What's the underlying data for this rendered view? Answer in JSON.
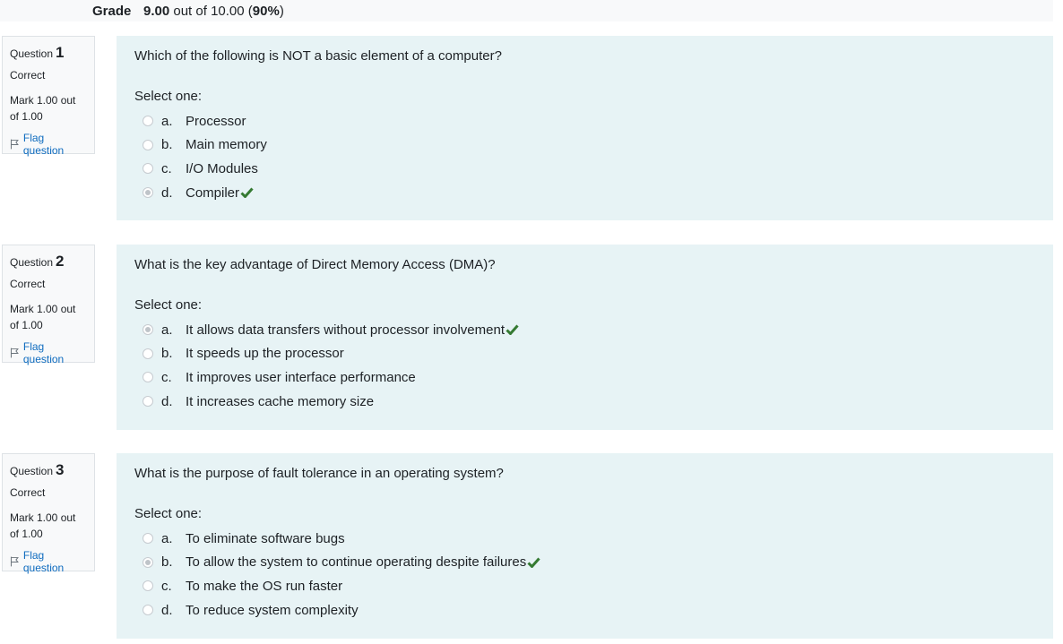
{
  "header": {
    "grade_label": "Grade",
    "grade_score": "9.00",
    "grade_out_of": " out of 10.00 (",
    "grade_percent": "90%",
    "grade_close": ")"
  },
  "questions": [
    {
      "label": "Question",
      "number": "1",
      "state": "Correct",
      "mark": "Mark 1.00 out of 1.00",
      "flag": "Flag question",
      "text": "Which of the following is NOT a basic element of a computer?",
      "prompt": "Select one:",
      "options": [
        {
          "letter": "a.",
          "text": "Processor",
          "checked": false,
          "correct": false
        },
        {
          "letter": "b.",
          "text": "Main memory",
          "checked": false,
          "correct": false
        },
        {
          "letter": "c.",
          "text": "I/O Modules",
          "checked": false,
          "correct": false
        },
        {
          "letter": "d.",
          "text": "Compiler",
          "checked": true,
          "correct": true
        }
      ]
    },
    {
      "label": "Question",
      "number": "2",
      "state": "Correct",
      "mark": "Mark 1.00 out of 1.00",
      "flag": "Flag question",
      "text": "What is the key advantage of Direct Memory Access (DMA)?",
      "prompt": "Select one:",
      "options": [
        {
          "letter": "a.",
          "text": "It allows data transfers without processor involvement",
          "checked": true,
          "correct": true
        },
        {
          "letter": "b.",
          "text": "It speeds up the processor",
          "checked": false,
          "correct": false
        },
        {
          "letter": "c.",
          "text": "It improves user interface performance",
          "checked": false,
          "correct": false
        },
        {
          "letter": "d.",
          "text": "It increases cache memory size",
          "checked": false,
          "correct": false
        }
      ]
    },
    {
      "label": "Question",
      "number": "3",
      "state": "Correct",
      "mark": "Mark 1.00 out of 1.00",
      "flag": "Flag question",
      "text": "What is the purpose of fault tolerance in an operating system?",
      "prompt": "Select one:",
      "options": [
        {
          "letter": "a.",
          "text": "To eliminate software bugs",
          "checked": false,
          "correct": false
        },
        {
          "letter": "b.",
          "text": "To allow the system to continue operating despite failures",
          "checked": true,
          "correct": true
        },
        {
          "letter": "c.",
          "text": "To make the OS run faster",
          "checked": false,
          "correct": false
        },
        {
          "letter": "d.",
          "text": "To reduce system complexity",
          "checked": false,
          "correct": false
        }
      ]
    }
  ],
  "colors": {
    "correct_check": "#357a32",
    "link": "#0f6cbf",
    "content_bg": "#e7f3f5"
  }
}
